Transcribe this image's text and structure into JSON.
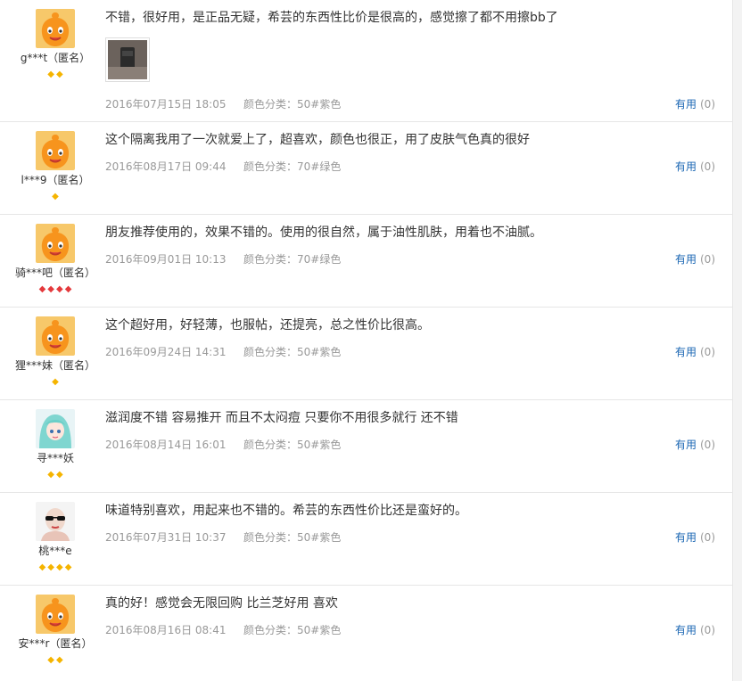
{
  "reviews": [
    {
      "user": "g***t（匿名）",
      "avatar_icon": "orange-mascot-avatar",
      "grade_icons": [
        "yellow",
        "yellow"
      ],
      "text": "不错，很好用，是正品无疑，希芸的东西性比价是很高的，感觉擦了都不用擦bb了",
      "has_image": true,
      "date": "2016年07月15日 18:05",
      "color": "颜色分类：50#紫色",
      "useful_label": "有用",
      "useful_count": "(0)"
    },
    {
      "user": "l***9（匿名）",
      "avatar_icon": "orange-mascot-avatar",
      "grade_icons": [
        "yellow"
      ],
      "text": "这个隔离我用了一次就爱上了，超喜欢，颜色也很正，用了皮肤气色真的很好",
      "has_image": false,
      "date": "2016年08月17日 09:44",
      "color": "颜色分类：70#绿色",
      "useful_label": "有用",
      "useful_count": "(0)"
    },
    {
      "user": "骑***吧（匿名）",
      "avatar_icon": "orange-mascot-avatar",
      "grade_icons": [
        "red",
        "red",
        "red",
        "red"
      ],
      "text": "朋友推荐使用的，效果不错的。使用的很自然，属于油性肌肤，用着也不油腻。",
      "has_image": false,
      "date": "2016年09月01日 10:13",
      "color": "颜色分类：70#绿色",
      "useful_label": "有用",
      "useful_count": "(0)"
    },
    {
      "user": "狸***妹（匿名）",
      "avatar_icon": "orange-mascot-avatar",
      "grade_icons": [
        "yellow"
      ],
      "text": "这个超好用，好轻薄，也服帖，还提亮，总之性价比很高。",
      "has_image": false,
      "date": "2016年09月24日 14:31",
      "color": "颜色分类：50#紫色",
      "useful_label": "有用",
      "useful_count": "(0)"
    },
    {
      "user": "寻***妖",
      "avatar_icon": "anime-girl-avatar",
      "grade_icons": [
        "yellow",
        "yellow"
      ],
      "text": "滋润度不错 容易推开 而且不太闷痘 只要你不用很多就行 还不错",
      "has_image": false,
      "date": "2016年08月14日 16:01",
      "color": "颜色分类：50#紫色",
      "useful_label": "有用",
      "useful_count": "(0)"
    },
    {
      "user": "桃***e",
      "avatar_icon": "sunglasses-person-avatar",
      "grade_icons": [
        "yellow",
        "yellow",
        "yellow",
        "yellow"
      ],
      "text": "味道特别喜欢，用起来也不错的。希芸的东西性价比还是蛮好的。",
      "has_image": false,
      "date": "2016年07月31日 10:37",
      "color": "颜色分类：50#紫色",
      "useful_label": "有用",
      "useful_count": "(0)"
    },
    {
      "user": "安***r（匿名）",
      "avatar_icon": "orange-mascot-avatar",
      "grade_icons": [
        "yellow",
        "yellow"
      ],
      "text": "真的好！感觉会无限回购 比兰芝好用 喜欢",
      "has_image": false,
      "date": "2016年08月16日 08:41",
      "color": "颜色分类：50#紫色",
      "useful_label": "有用",
      "useful_count": "(0)"
    }
  ],
  "colors": {
    "link_blue": "#1a66b3",
    "meta_gray": "#999999",
    "grade_yellow": "#f5b400",
    "grade_red": "#e4393c",
    "mascot_orange": "#f7941d"
  }
}
